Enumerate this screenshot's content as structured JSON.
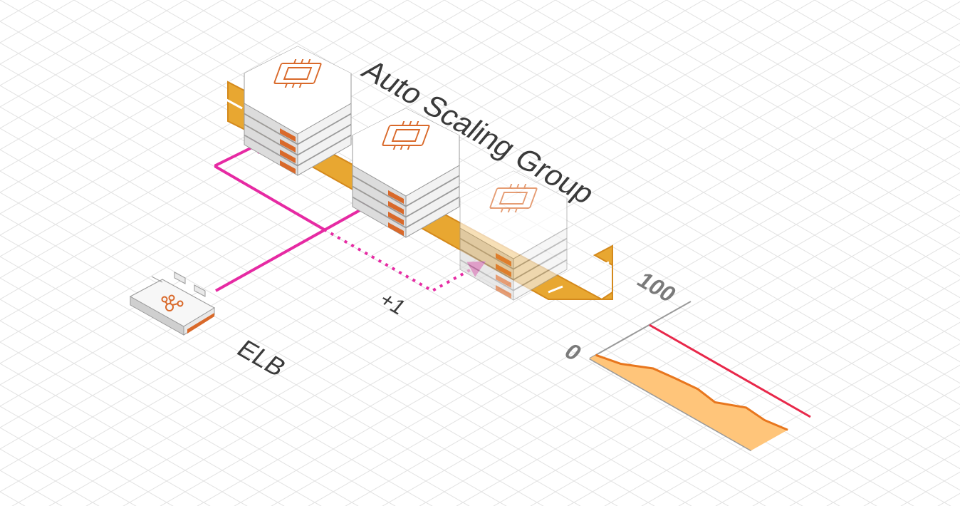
{
  "group": {
    "label": "Auto Scaling Group",
    "band_color": "#E8A731",
    "band_edge_color": "#D4891C"
  },
  "load_balancer": {
    "label": "ELB",
    "icon": "load-balancer-icon",
    "accent_color": "#D9692A"
  },
  "instances": [
    {
      "icon": "ec2-instance-icon",
      "state": "running"
    },
    {
      "icon": "ec2-instance-icon",
      "state": "running"
    },
    {
      "icon": "ec2-instance-icon",
      "state": "launching"
    }
  ],
  "connections": {
    "color": "#E62AA3",
    "scale_out_label": "+1"
  },
  "chart_data": {
    "type": "area",
    "y_axis_labels": [
      "0",
      "100"
    ],
    "ylim": [
      0,
      100
    ],
    "x": [
      0,
      1,
      2,
      3,
      4,
      5,
      6,
      7,
      8
    ],
    "values": [
      10,
      18,
      38,
      42,
      45,
      40,
      58,
      55,
      60
    ],
    "threshold": 50,
    "fill_color": "#FFC57A",
    "line_color": "#E8761D",
    "threshold_color": "#E8284A",
    "grid": false
  }
}
